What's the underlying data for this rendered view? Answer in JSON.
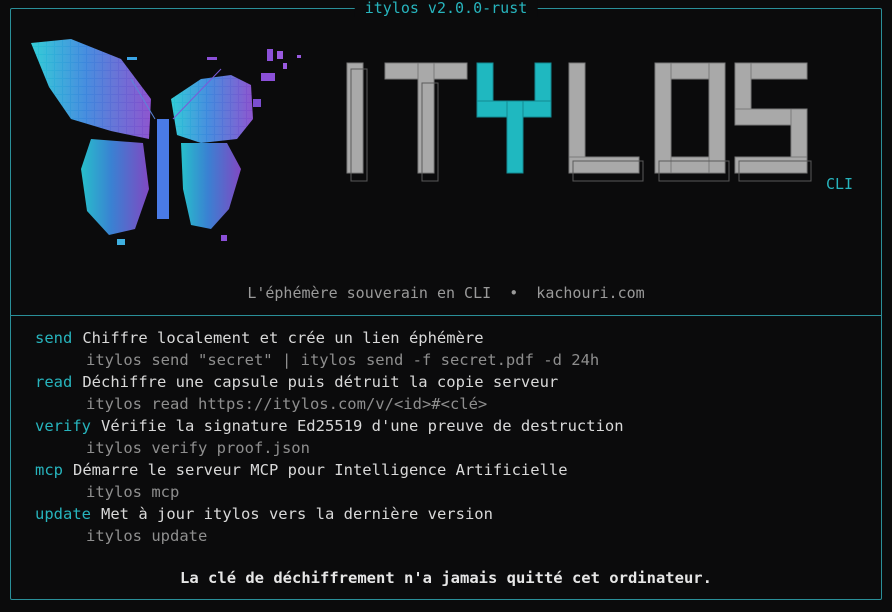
{
  "window": {
    "title": "itylos v2.0.0-rust"
  },
  "brand": {
    "logo_text": "ITYLOS",
    "tag": "CLI",
    "art": "butterfly-logo"
  },
  "tagline": "L'éphémère souverain en CLI  •  kachouri.com",
  "commands": [
    {
      "name": "send",
      "description": "Chiffre localement et crée un lien éphémère",
      "example": "itylos send \"secret\" | itylos send -f secret.pdf -d 24h"
    },
    {
      "name": "read",
      "description": "Déchiffre une capsule puis détruit la copie serveur",
      "example": "itylos read https://itylos.com/v/<id>#<clé>"
    },
    {
      "name": "verify",
      "description": "Vérifie la signature Ed25519 d'une preuve de destruction",
      "example": "itylos verify proof.json"
    },
    {
      "name": "mcp",
      "description": "Démarre le serveur MCP pour Intelligence Artificielle",
      "example": "itylos mcp"
    },
    {
      "name": "update",
      "description": "Met à jour itylos vers la dernière version",
      "example": "itylos update"
    }
  ],
  "footer": "La clé de déchiffrement n'a jamais quitté cet ordinateur.",
  "colors": {
    "accent": "#27b4bd",
    "border": "#2a8f99",
    "logo_gray": "#a9a9a9",
    "logo_highlight": "#1fb8c0",
    "background": "#0b0b0c"
  }
}
